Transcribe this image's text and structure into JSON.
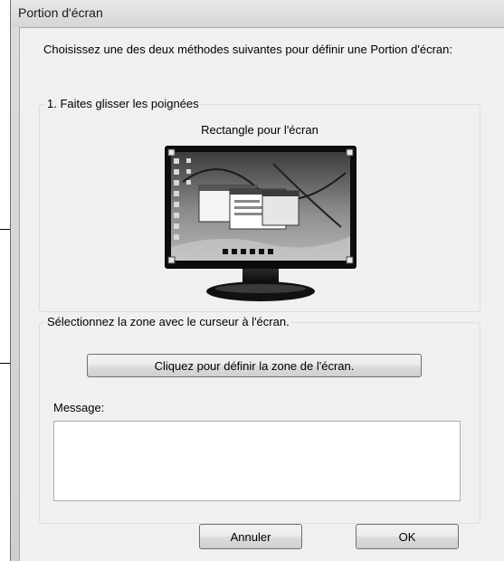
{
  "window": {
    "title": "Portion d'écran"
  },
  "intro_text": "Choisissez une des deux méthodes suivantes pour définir une Portion d'écran:",
  "group_handles": {
    "legend": "1. Faites glisser les poignées",
    "rect_title": "Rectangle pour l'écran"
  },
  "group_cursor": {
    "legend": "Sélectionnez la zone avec le curseur à l'écran.",
    "define_button": "Cliquez pour définir la zone de l'écran.",
    "message_label": "Message:",
    "message_value": ""
  },
  "buttons": {
    "cancel": "Annuler",
    "ok": "OK"
  }
}
